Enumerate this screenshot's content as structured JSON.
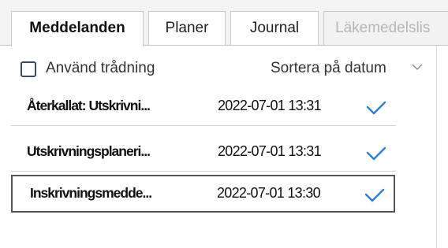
{
  "tabs": [
    {
      "label": "Meddelanden",
      "active": true
    },
    {
      "label": "Planer",
      "active": false
    },
    {
      "label": "Journal",
      "active": false
    },
    {
      "label": "Läkemedelslis",
      "active": false,
      "disabled": true
    }
  ],
  "toolbar": {
    "threading_label": "Använd trådning",
    "threading_checked": false,
    "sort_label": "Sortera på datum",
    "sort_icon": "chevron-down-icon"
  },
  "messages": [
    {
      "title": "Återkallat: Utskrivni...",
      "date": "2022-07-01 13:31",
      "status_icon": "checkmark-icon",
      "selected": false
    },
    {
      "title": "Utskrivningsplaneri...",
      "date": "2022-07-01 13:31",
      "status_icon": "checkmark-icon",
      "selected": false
    },
    {
      "title": "Inskrivningsmedde...",
      "date": "2022-07-01 13:30",
      "status_icon": "checkmark-icon",
      "selected": true
    }
  ],
  "colors": {
    "accent_check": "#2b7fd6",
    "checkbox_border": "#3b4a60"
  }
}
